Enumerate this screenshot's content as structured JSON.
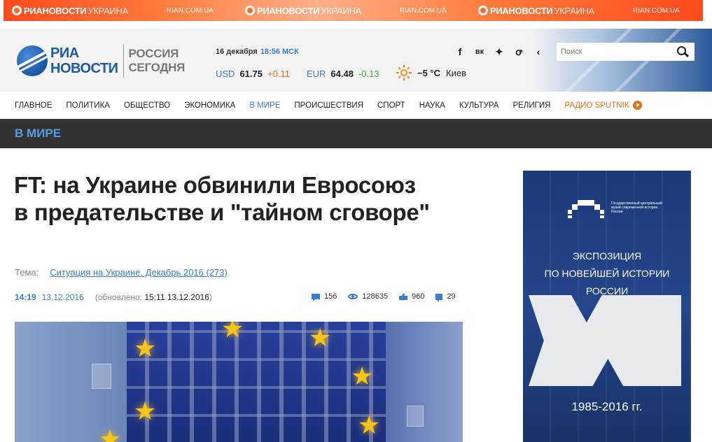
{
  "top_banner": {
    "logo_main": "РИАНОВОСТИ",
    "logo_sub": "УКРАИНА",
    "url": "RIAN.COM.UA"
  },
  "header": {
    "logo_line1": "РИА",
    "logo_line2": "НОВОСТИ",
    "partner_line1": "РОССИЯ",
    "partner_line2": "СЕГОДНЯ",
    "date": "16 декабря",
    "time": "18:56 МСК",
    "rates": [
      {
        "currency": "USD",
        "value": "61.75",
        "change": "+0.11"
      },
      {
        "currency": "EUR",
        "value": "64.48",
        "change": "-0.13"
      }
    ],
    "weather": {
      "temp": "−5 °C",
      "city": "Киев"
    },
    "search_placeholder": "Поиск"
  },
  "socials": [
    "f",
    "vk",
    "tw",
    "ok",
    "share"
  ],
  "nav": {
    "items": [
      "ГЛАВНОЕ",
      "ПОЛИТИКА",
      "ОБЩЕСТВО",
      "ЭКОНОМИКА",
      "В МИРЕ",
      "ПРОИСШЕСТВИЯ",
      "СПОРТ",
      "НАУКА",
      "КУЛЬТУРА",
      "РЕЛИГИЯ"
    ],
    "active": "В МИРЕ",
    "radio": "РАДИО SPUTNIK"
  },
  "section": {
    "title": "В МИРЕ"
  },
  "article": {
    "title": "FT: на Украине обвинили Евросоюз в предательстве и \"тайном сговоре\"",
    "theme_label": "Тема:",
    "theme_link": "Ситуация на Украине. Декабрь 2016 (273)",
    "time": "14:19",
    "date": "13.12.2016",
    "updated_prefix": "(обновлено: ",
    "updated_value": "15:11 13.12.2016",
    "updated_suffix": ")",
    "stats": {
      "comments": "156",
      "views": "128635",
      "likes": "960",
      "shares": "29"
    }
  },
  "ad": {
    "org": "Государственный центральный музей современной истории России",
    "line1": "ЭКСПОЗИЦИЯ",
    "line2": "ПО НОВЕЙШЕЙ ИСТОРИИ РОССИИ",
    "years": "1985-2016 гг."
  }
}
